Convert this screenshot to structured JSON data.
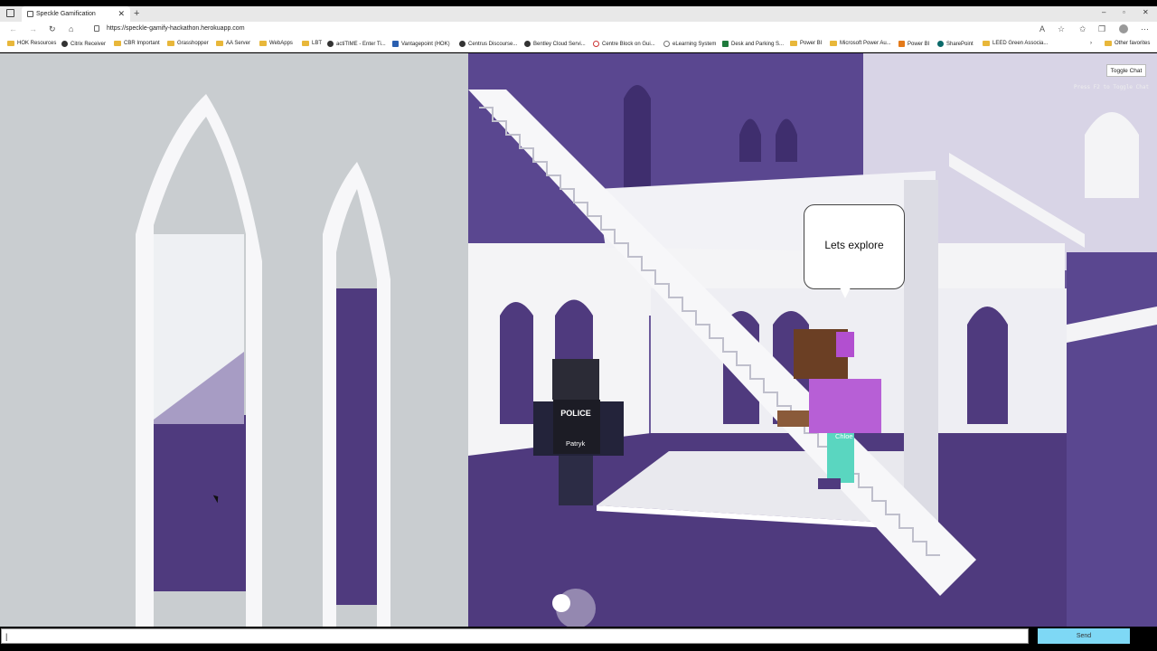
{
  "browser": {
    "tab_title": "Speckle Gamification",
    "url": "https://speckle-gamify-hackathon.herokuapp.com",
    "win_minimize": "–",
    "win_maximize": "▫",
    "win_close": "✕",
    "tab_close": "✕",
    "tab_add": "+"
  },
  "bookmarks": [
    "HOK Resources",
    "Citrix Receiver",
    "CBR Important",
    "Grasshopper",
    "AA Server",
    "WebApps",
    "LBT",
    "actiTIME - Enter Ti...",
    "Vantagepoint (HOK)",
    "Centrus Discourse...",
    "Bentley Cloud Servi...",
    "Centre Block on Gui...",
    "eLearning System",
    "Desk and Parking S...",
    "Power BI",
    "Microsoft Power Au...",
    "Power BI",
    "SharePoint",
    "LEED Green Associa..."
  ],
  "bookmarks_other": "Other favorites",
  "game": {
    "toggle_chat": "Toggle Chat",
    "toggle_hint": "Press F2 to Toggle Chat",
    "speech_bubble": "Lets explore",
    "player1_name": "Patryk",
    "player1_vest": "POLICE",
    "player2_name": "Chloe"
  },
  "chat": {
    "input_value": "|",
    "send_label": "Send"
  },
  "colors": {
    "purple": "#4f3a7e",
    "purple_light": "#7a68a8",
    "wall": "#f4f4f6",
    "sky": "#c9cdd0",
    "send": "#7ed8f5"
  }
}
